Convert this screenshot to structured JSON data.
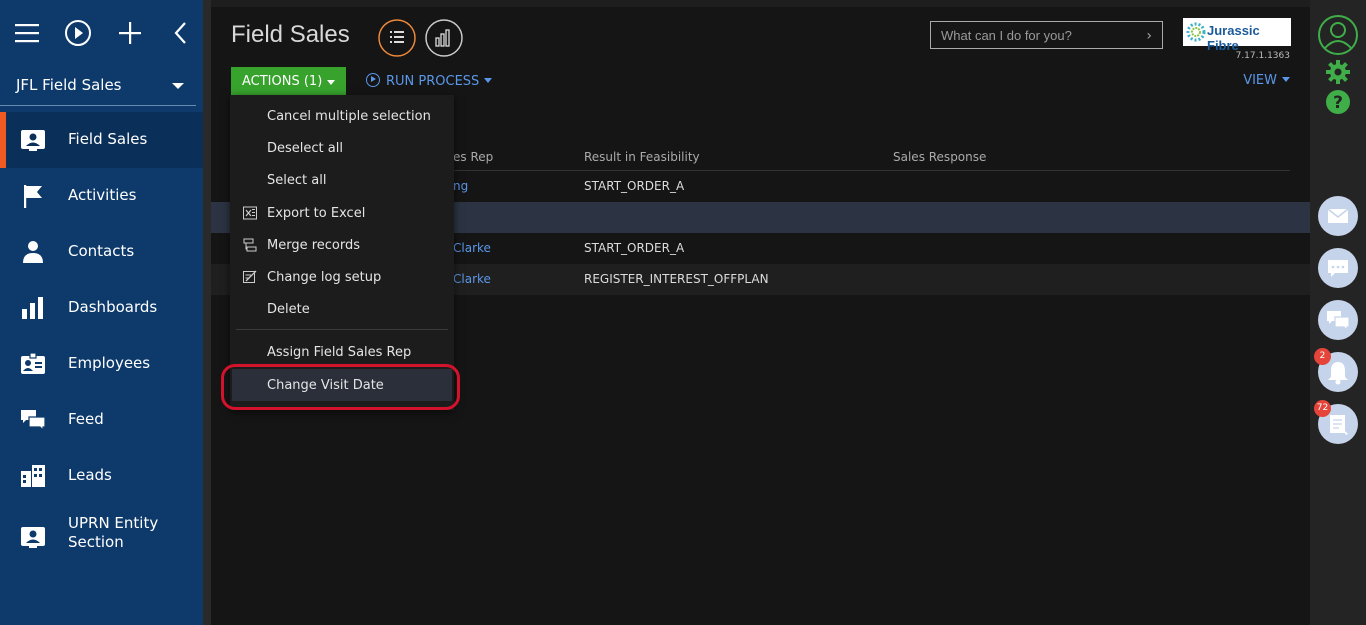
{
  "sidebar": {
    "workspace": "JFL Field Sales",
    "items": [
      {
        "label": "Field Sales",
        "icon": "contact-card-icon",
        "active": true
      },
      {
        "label": "Activities",
        "icon": "flag-icon"
      },
      {
        "label": "Contacts",
        "icon": "person-icon"
      },
      {
        "label": "Dashboards",
        "icon": "bar-chart-icon"
      },
      {
        "label": "Employees",
        "icon": "id-badge-icon"
      },
      {
        "label": "Feed",
        "icon": "chat-bubbles-icon"
      },
      {
        "label": "Leads",
        "icon": "buildings-icon"
      },
      {
        "label": "UPRN Entity Section",
        "icon": "contact-card-icon"
      }
    ]
  },
  "header": {
    "title": "Field Sales",
    "search_placeholder": "What can I do for you?",
    "logo_text": "Jurassic Fibre",
    "version": "7.17.1.1363",
    "actions_label": "ACTIONS (1)",
    "run_process_label": "RUN PROCESS",
    "view_label": "VIEW"
  },
  "table": {
    "columns": [
      "es Rep",
      "Result in Feasibility",
      "Sales Response"
    ],
    "rows": [
      {
        "rep": "ng",
        "result": "START_ORDER_A",
        "response": ""
      },
      {
        "rep": "",
        "result": "",
        "response": ""
      },
      {
        "rep": "Clarke",
        "result": "START_ORDER_A",
        "response": ""
      },
      {
        "rep": "Clarke",
        "result": "REGISTER_INTEREST_OFFPLAN",
        "response": ""
      }
    ]
  },
  "actions_menu": {
    "items": [
      {
        "label": "Cancel multiple selection",
        "icon": ""
      },
      {
        "label": "Deselect all",
        "icon": ""
      },
      {
        "label": "Select all",
        "icon": ""
      },
      {
        "label": "Export to Excel",
        "icon": "excel-icon"
      },
      {
        "label": "Merge records",
        "icon": "merge-icon"
      },
      {
        "label": "Change log setup",
        "icon": "change-log-icon"
      },
      {
        "label": "Delete",
        "icon": ""
      },
      {
        "label": "Assign Field Sales Rep",
        "icon": ""
      },
      {
        "label": "Change Visit Date",
        "icon": "",
        "highlighted": true
      }
    ]
  },
  "rightbar": {
    "notifications_count": "2",
    "tasks_count": "72"
  },
  "colors": {
    "sidebar": "#0d3a6b",
    "accent_orange": "#f15a22",
    "actions_green": "#37a32d",
    "link_blue": "#5a97e8",
    "highlight_red": "#d3122b"
  }
}
